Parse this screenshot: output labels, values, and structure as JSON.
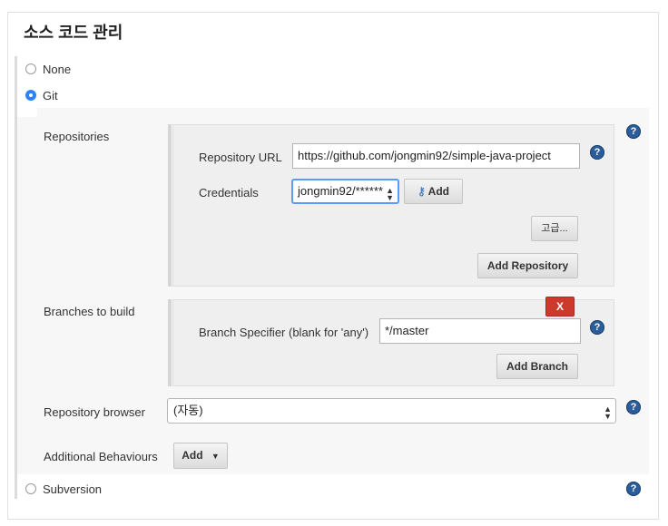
{
  "page": {
    "section_title": "소스 코드 관리"
  },
  "scm": {
    "none_label": "None",
    "git_label": "Git",
    "subversion_label": "Subversion",
    "selected": "Git"
  },
  "git": {
    "repositories_label": "Repositories",
    "repository_url_label": "Repository URL",
    "repository_url_value": "https://github.com/jongmin92/simple-java-project",
    "credentials_label": "Credentials",
    "credentials_value": "jongmin92/******",
    "add_credentials_label": "Add",
    "advanced_label": "고급...",
    "add_repository_label": "Add Repository",
    "branches_label": "Branches to build",
    "branch_specifier_label": "Branch Specifier (blank for 'any')",
    "branch_specifier_value": "*/master",
    "delete_branch_label": "X",
    "add_branch_label": "Add Branch",
    "repository_browser_label": "Repository browser",
    "repository_browser_value": "(자동)",
    "additional_behaviours_label": "Additional Behaviours",
    "add_behaviour_label": "Add"
  },
  "icons": {
    "help": "help-icon",
    "key": "key-icon",
    "select_arrows": "updown-arrows-icon",
    "dropdown": "caret-down-icon"
  },
  "colors": {
    "radio_selected": "#2b84f5",
    "help_icon": "#2a5d99",
    "delete_button": "#cc3a2e",
    "focus_ring": "#5b9bf7"
  }
}
